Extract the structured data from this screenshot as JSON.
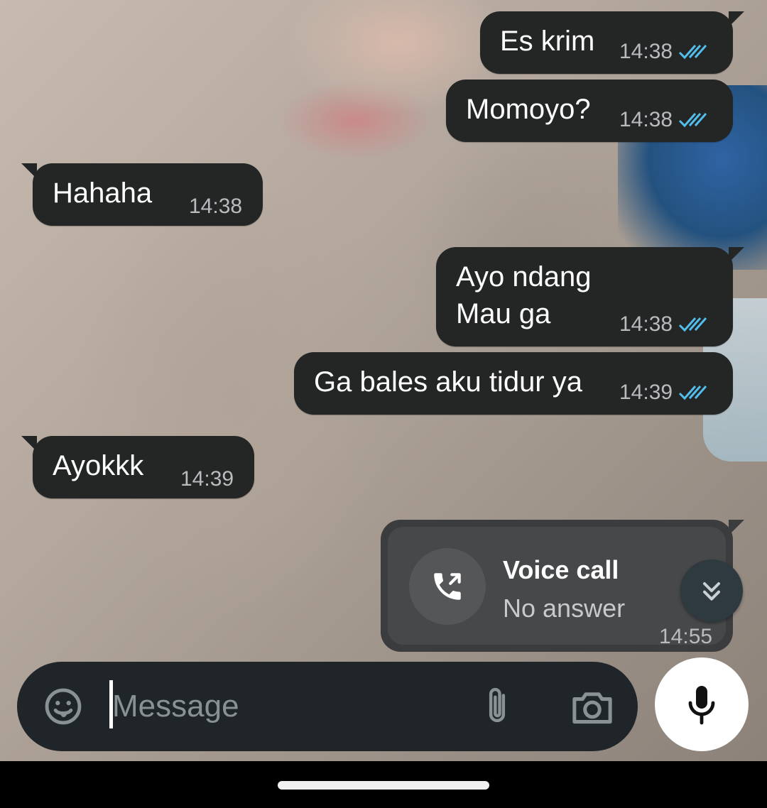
{
  "messages": [
    {
      "direction": "out",
      "text": "Es krim",
      "time": "14:38"
    },
    {
      "direction": "out",
      "text": "Momoyo?",
      "time": "14:38"
    },
    {
      "direction": "in",
      "text": "Hahaha",
      "time": "14:38"
    },
    {
      "direction": "out",
      "text": "Ayo ndang\nMau ga",
      "time": "14:38"
    },
    {
      "direction": "out",
      "text": "Ga bales aku tidur ya",
      "time": "14:39"
    },
    {
      "direction": "in",
      "text": "Ayokkk",
      "time": "14:39"
    }
  ],
  "voice_call": {
    "title": "Voice call",
    "status": "No answer",
    "time": "14:55"
  },
  "composer": {
    "placeholder": "Message"
  },
  "icons": {
    "read_receipt": "double-check-icon",
    "call": "outgoing-call-icon",
    "scroll": "chevron-double-down-icon",
    "emoji": "sticker-icon",
    "attach": "paperclip-icon",
    "camera": "camera-icon",
    "mic": "microphone-icon"
  },
  "colors": {
    "bubble": "#242626",
    "tick": "#53bdeb",
    "composer": "#1f2528"
  }
}
